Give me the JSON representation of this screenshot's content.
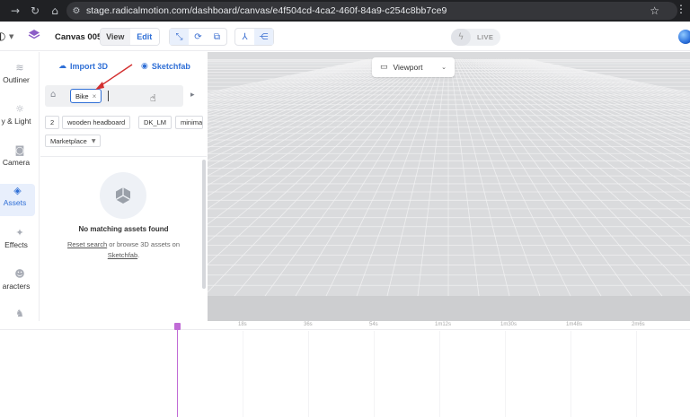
{
  "browser": {
    "url": "stage.radicalmotion.com/dashboard/canvas/e4f504cd-4ca2-460f-84a9-c254c8bb7ce9"
  },
  "header": {
    "canvas_title": "Canvas 005",
    "mode_view": "View",
    "mode_edit": "Edit",
    "live_label": "LIVE"
  },
  "leftnav": {
    "items": [
      {
        "label": "Outliner",
        "icon": "database-icon"
      },
      {
        "label": "y & Light",
        "icon": "sun-icon"
      },
      {
        "label": "Camera",
        "icon": "camera-icon"
      },
      {
        "label": "Assets",
        "icon": "assets-icon"
      },
      {
        "label": "Effects",
        "icon": "sparkle-icon"
      },
      {
        "label": "aracters",
        "icon": "mask-icon"
      },
      {
        "label": "",
        "icon": "running-figure-icon"
      }
    ]
  },
  "panel": {
    "tab_import": "Import 3D",
    "tab_sketchfab": "Sketchfab",
    "search_chip": "Bike",
    "tags": [
      "2",
      "wooden headboard",
      "DK_LM",
      "minima"
    ],
    "marketplace": "Marketplace",
    "empty_title": "No matching assets found",
    "empty_link_reset": "Reset search",
    "empty_text_mid": " or browse 3D assets on ",
    "empty_link_sketchfab": "Sketchfab",
    "empty_text_end": "."
  },
  "viewport": {
    "view_label": "Viewport"
  },
  "timeline": {
    "ticks": [
      "18s",
      "36s",
      "54s",
      "1m12s",
      "1m30s",
      "1m48s",
      "2m6s"
    ]
  },
  "colors": {
    "accent": "#2f6fd6",
    "playhead": "#c06bd6",
    "annotation": "#d32f2f"
  }
}
